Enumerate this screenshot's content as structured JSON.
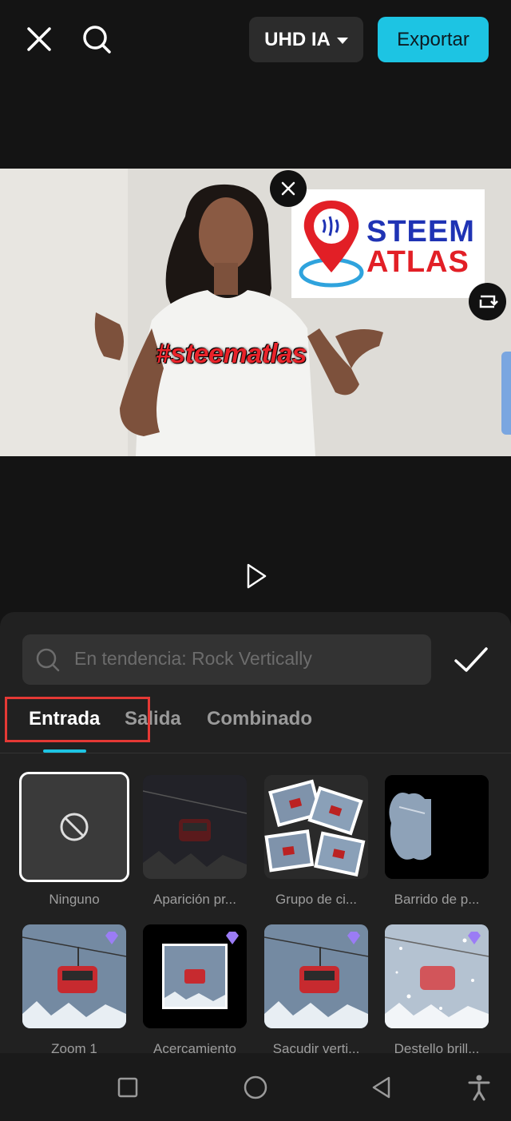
{
  "header": {
    "quality_label": "UHD IA",
    "export_label": "Exportar"
  },
  "preview": {
    "hashtag": "#steematlas",
    "logo_line1": "STEEM",
    "logo_line2": "ATLAS"
  },
  "panel": {
    "search_placeholder": "En tendencia: Rock Vertically",
    "tabs": [
      {
        "label": "Entrada"
      },
      {
        "label": "Salida"
      },
      {
        "label": "Combinado"
      }
    ],
    "effects": [
      {
        "label": "Ninguno"
      },
      {
        "label": "Aparición pr..."
      },
      {
        "label": "Grupo de ci..."
      },
      {
        "label": "Barrido de p..."
      },
      {
        "label": "Zoom 1"
      },
      {
        "label": "Acercamiento"
      },
      {
        "label": "Sacudir verti..."
      },
      {
        "label": "Destello brill..."
      }
    ]
  },
  "colors": {
    "accent": "#1dc4e3",
    "highlight": "#e53935",
    "premium": "#9b7cf5"
  },
  "icons": [
    "close-icon",
    "search-icon",
    "caret-down-icon",
    "play-icon",
    "check-icon",
    "none-icon",
    "premium-gem-icon",
    "nav-recents-icon",
    "nav-home-icon",
    "nav-back-icon",
    "accessibility-icon"
  ]
}
